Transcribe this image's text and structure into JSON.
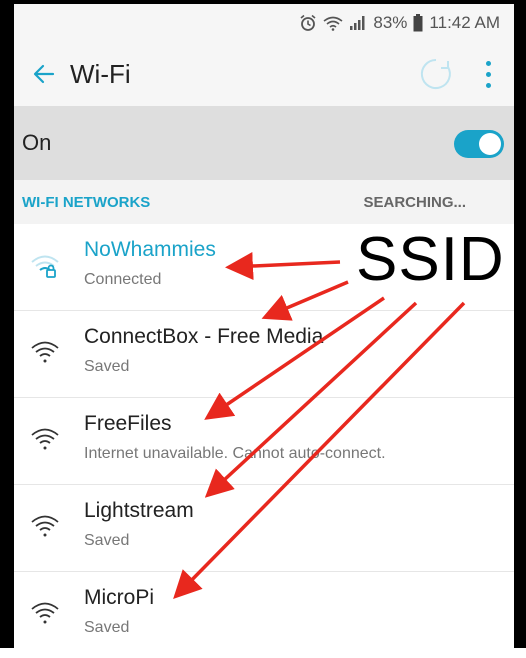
{
  "status_bar": {
    "alarm_icon": "alarm-icon",
    "wifi_icon": "wifi-status-icon",
    "signal_icon": "signal-bars-icon",
    "battery_percent": "83%",
    "battery_icon": "battery-icon",
    "time": "11:42 AM"
  },
  "app_bar": {
    "title": "Wi-Fi",
    "back_icon": "back-arrow-icon",
    "refresh_icon": "refresh-icon",
    "more_icon": "more-vert-icon"
  },
  "wifi_toggle": {
    "label": "On",
    "state": "on"
  },
  "section": {
    "title": "WI-FI NETWORKS",
    "status": "SEARCHING..."
  },
  "networks": [
    {
      "name": "NoWhammies",
      "status": "Connected",
      "locked": true,
      "connected": true
    },
    {
      "name": "ConnectBox - Free Media",
      "status": "Saved"
    },
    {
      "name": "FreeFiles",
      "status": "Internet unavailable. Cannot auto-connect."
    },
    {
      "name": "Lightstream",
      "status": "Saved"
    },
    {
      "name": "MicroPi",
      "status": "Saved"
    }
  ],
  "annotation": {
    "label": "SSID",
    "arrow_color": "#e8281e"
  },
  "colors": {
    "accent": "#1aa3c9",
    "header_bg": "#f6f6f6",
    "toggle_bg": "#dedede"
  }
}
